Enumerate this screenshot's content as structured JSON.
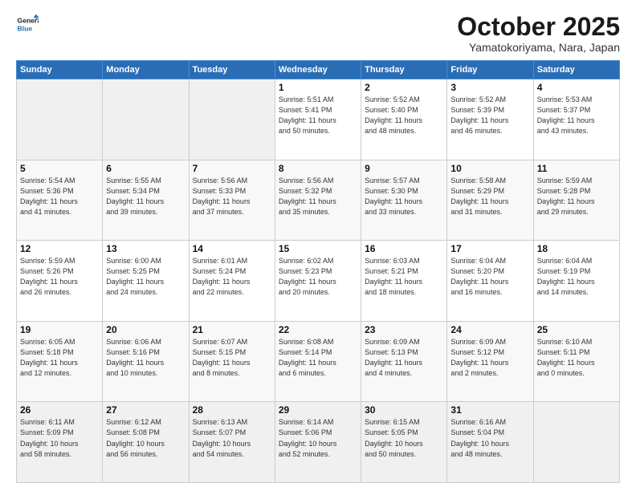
{
  "logo": {
    "line1": "General",
    "line2": "Blue"
  },
  "header": {
    "month": "October 2025",
    "location": "Yamatokoriyama, Nara, Japan"
  },
  "weekdays": [
    "Sunday",
    "Monday",
    "Tuesday",
    "Wednesday",
    "Thursday",
    "Friday",
    "Saturday"
  ],
  "weeks": [
    [
      {
        "day": "",
        "info": ""
      },
      {
        "day": "",
        "info": ""
      },
      {
        "day": "",
        "info": ""
      },
      {
        "day": "1",
        "info": "Sunrise: 5:51 AM\nSunset: 5:41 PM\nDaylight: 11 hours\nand 50 minutes."
      },
      {
        "day": "2",
        "info": "Sunrise: 5:52 AM\nSunset: 5:40 PM\nDaylight: 11 hours\nand 48 minutes."
      },
      {
        "day": "3",
        "info": "Sunrise: 5:52 AM\nSunset: 5:39 PM\nDaylight: 11 hours\nand 46 minutes."
      },
      {
        "day": "4",
        "info": "Sunrise: 5:53 AM\nSunset: 5:37 PM\nDaylight: 11 hours\nand 43 minutes."
      }
    ],
    [
      {
        "day": "5",
        "info": "Sunrise: 5:54 AM\nSunset: 5:36 PM\nDaylight: 11 hours\nand 41 minutes."
      },
      {
        "day": "6",
        "info": "Sunrise: 5:55 AM\nSunset: 5:34 PM\nDaylight: 11 hours\nand 39 minutes."
      },
      {
        "day": "7",
        "info": "Sunrise: 5:56 AM\nSunset: 5:33 PM\nDaylight: 11 hours\nand 37 minutes."
      },
      {
        "day": "8",
        "info": "Sunrise: 5:56 AM\nSunset: 5:32 PM\nDaylight: 11 hours\nand 35 minutes."
      },
      {
        "day": "9",
        "info": "Sunrise: 5:57 AM\nSunset: 5:30 PM\nDaylight: 11 hours\nand 33 minutes."
      },
      {
        "day": "10",
        "info": "Sunrise: 5:58 AM\nSunset: 5:29 PM\nDaylight: 11 hours\nand 31 minutes."
      },
      {
        "day": "11",
        "info": "Sunrise: 5:59 AM\nSunset: 5:28 PM\nDaylight: 11 hours\nand 29 minutes."
      }
    ],
    [
      {
        "day": "12",
        "info": "Sunrise: 5:59 AM\nSunset: 5:26 PM\nDaylight: 11 hours\nand 26 minutes."
      },
      {
        "day": "13",
        "info": "Sunrise: 6:00 AM\nSunset: 5:25 PM\nDaylight: 11 hours\nand 24 minutes."
      },
      {
        "day": "14",
        "info": "Sunrise: 6:01 AM\nSunset: 5:24 PM\nDaylight: 11 hours\nand 22 minutes."
      },
      {
        "day": "15",
        "info": "Sunrise: 6:02 AM\nSunset: 5:23 PM\nDaylight: 11 hours\nand 20 minutes."
      },
      {
        "day": "16",
        "info": "Sunrise: 6:03 AM\nSunset: 5:21 PM\nDaylight: 11 hours\nand 18 minutes."
      },
      {
        "day": "17",
        "info": "Sunrise: 6:04 AM\nSunset: 5:20 PM\nDaylight: 11 hours\nand 16 minutes."
      },
      {
        "day": "18",
        "info": "Sunrise: 6:04 AM\nSunset: 5:19 PM\nDaylight: 11 hours\nand 14 minutes."
      }
    ],
    [
      {
        "day": "19",
        "info": "Sunrise: 6:05 AM\nSunset: 5:18 PM\nDaylight: 11 hours\nand 12 minutes."
      },
      {
        "day": "20",
        "info": "Sunrise: 6:06 AM\nSunset: 5:16 PM\nDaylight: 11 hours\nand 10 minutes."
      },
      {
        "day": "21",
        "info": "Sunrise: 6:07 AM\nSunset: 5:15 PM\nDaylight: 11 hours\nand 8 minutes."
      },
      {
        "day": "22",
        "info": "Sunrise: 6:08 AM\nSunset: 5:14 PM\nDaylight: 11 hours\nand 6 minutes."
      },
      {
        "day": "23",
        "info": "Sunrise: 6:09 AM\nSunset: 5:13 PM\nDaylight: 11 hours\nand 4 minutes."
      },
      {
        "day": "24",
        "info": "Sunrise: 6:09 AM\nSunset: 5:12 PM\nDaylight: 11 hours\nand 2 minutes."
      },
      {
        "day": "25",
        "info": "Sunrise: 6:10 AM\nSunset: 5:11 PM\nDaylight: 11 hours\nand 0 minutes."
      }
    ],
    [
      {
        "day": "26",
        "info": "Sunrise: 6:11 AM\nSunset: 5:09 PM\nDaylight: 10 hours\nand 58 minutes."
      },
      {
        "day": "27",
        "info": "Sunrise: 6:12 AM\nSunset: 5:08 PM\nDaylight: 10 hours\nand 56 minutes."
      },
      {
        "day": "28",
        "info": "Sunrise: 6:13 AM\nSunset: 5:07 PM\nDaylight: 10 hours\nand 54 minutes."
      },
      {
        "day": "29",
        "info": "Sunrise: 6:14 AM\nSunset: 5:06 PM\nDaylight: 10 hours\nand 52 minutes."
      },
      {
        "day": "30",
        "info": "Sunrise: 6:15 AM\nSunset: 5:05 PM\nDaylight: 10 hours\nand 50 minutes."
      },
      {
        "day": "31",
        "info": "Sunrise: 6:16 AM\nSunset: 5:04 PM\nDaylight: 10 hours\nand 48 minutes."
      },
      {
        "day": "",
        "info": ""
      }
    ]
  ]
}
